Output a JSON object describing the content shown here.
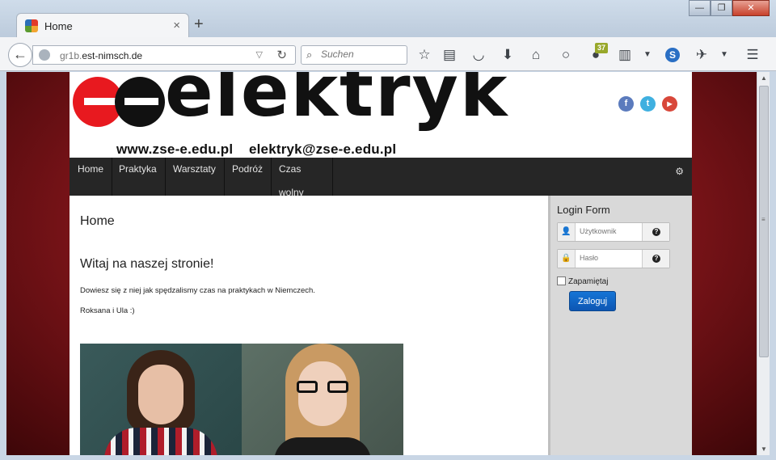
{
  "window": {
    "tab_title": "Home",
    "tab_close": "×",
    "new_tab": "+",
    "controls": {
      "minimize": "—",
      "maximize": "❐",
      "close": "✕"
    }
  },
  "toolbar": {
    "back": "←",
    "url_prefix": "gr1b.",
    "url_domain": "est-nimsch.de",
    "url_dropdown": "▽",
    "reload": "↻",
    "search_placeholder": "Suchen",
    "search_icon": "⌕",
    "notification_count": "37",
    "menu_icon": "☰"
  },
  "site": {
    "logo_word": "elektryk",
    "logo_contact": "www.zse-e.edu.pl    elektryk@zse-e.edu.pl",
    "social": {
      "facebook": "f",
      "twitter": "t",
      "youtube": "▶"
    },
    "menu": [
      {
        "label": "Home"
      },
      {
        "label": "Praktyka"
      },
      {
        "label": "Warsztaty"
      },
      {
        "label": "Podróż"
      },
      {
        "label": "Czas wolny"
      }
    ],
    "menu_settings": "⚙"
  },
  "main": {
    "page_heading": "Home",
    "article_title": "Witaj na naszej stronie!",
    "paragraph1": "Dowiesz się z niej jak spędzalismy czas na praktykach w Niemczech.",
    "paragraph2": "Roksana i Ula :)"
  },
  "login": {
    "title": "Login Form",
    "username_placeholder": "Użytkownik",
    "password_placeholder": "Hasło",
    "help_symbol": "?",
    "remember_label": "Zapamiętaj",
    "submit_label": "Zaloguj"
  },
  "colors": {
    "accent_blue": "#0d56b3",
    "menu_bg": "#262626",
    "page_bg_red": "#7c1419",
    "logo_red": "#e8191f"
  }
}
